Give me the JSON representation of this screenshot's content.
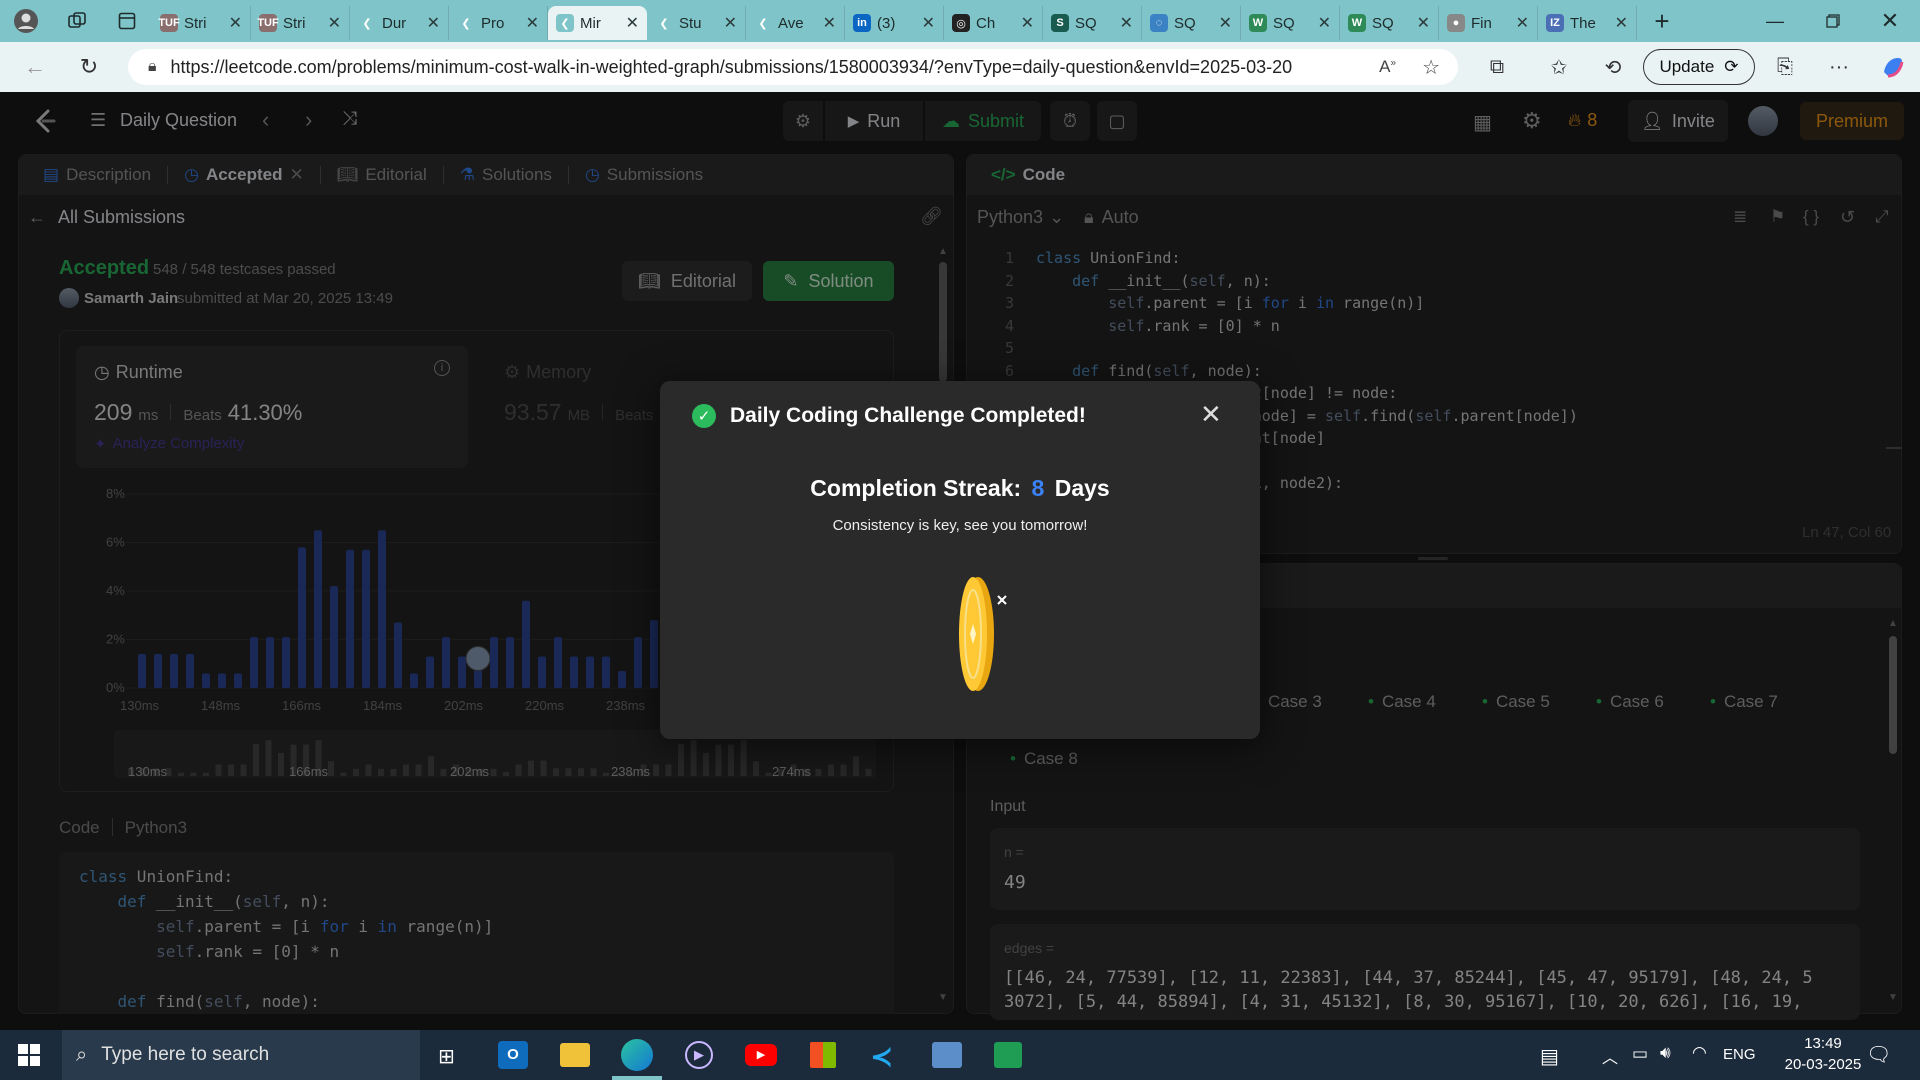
{
  "browser": {
    "tabs": [
      {
        "title": "Stri",
        "fav_color": "#8a6d6d",
        "fav": "TUF"
      },
      {
        "title": "Stri",
        "fav_color": "#8a6d6d",
        "fav": "TUF"
      },
      {
        "title": "Dur",
        "fav_color": "#7fc4c8",
        "fav": "❮"
      },
      {
        "title": "Pro",
        "fav_color": "#7fc4c8",
        "fav": "❮"
      },
      {
        "title": "Mir",
        "fav_color": "#7fc4c8",
        "fav": "❮"
      },
      {
        "title": "Stu",
        "fav_color": "#7fc4c8",
        "fav": "❮"
      },
      {
        "title": "Ave",
        "fav_color": "#7fc4c8",
        "fav": "❮"
      },
      {
        "title": "(3)",
        "fav_color": "#0a66c2",
        "fav": "in"
      },
      {
        "title": "Ch",
        "fav_color": "#222222",
        "fav": "◎"
      },
      {
        "title": "SQ",
        "fav_color": "#1a5b50",
        "fav": "S"
      },
      {
        "title": "SQ",
        "fav_color": "#3b82c4",
        "fav": "◌"
      },
      {
        "title": "SQ",
        "fav_color": "#2e8b57",
        "fav": "W"
      },
      {
        "title": "SQ",
        "fav_color": "#2e8b57",
        "fav": "W"
      },
      {
        "title": "Fin",
        "fav_color": "#888888",
        "fav": "●"
      },
      {
        "title": "The",
        "fav_color": "#4a6fb5",
        "fav": "IZ"
      }
    ],
    "url": "https://leetcode.com/problems/minimum-cost-walk-in-weighted-graph/submissions/1580003934/?envType=daily-question&envId=2025-03-20",
    "update_label": "Update"
  },
  "header": {
    "daily_label": "Daily Question",
    "run_label": "Run",
    "submit_label": "Submit",
    "streak_count": "8",
    "invite_label": "Invite",
    "premium_label": "Premium"
  },
  "left_panel": {
    "tabs": [
      "Description",
      "Accepted",
      "Editorial",
      "Solutions",
      "Submissions"
    ],
    "all_submissions": "All Submissions",
    "status": "Accepted",
    "testcases": "548 / 548 testcases passed",
    "user": "Samarth Jain",
    "submitted_at": "submitted at Mar 20, 2025 13:49",
    "editorial_btn": "Editorial",
    "solution_btn": "Solution",
    "runtime_label": "Runtime",
    "runtime_value": "209",
    "runtime_unit": "ms",
    "beats_label": "Beats",
    "runtime_beats": "41.30%",
    "analyze_label": "Analyze Complexity",
    "memory_label": "Memory",
    "memory_value": "93.57",
    "memory_unit": "MB",
    "memory_beats_label": "Beats",
    "code_label": "Code",
    "code_lang": "Python3",
    "code_lines": [
      "class UnionFind:",
      "    def __init__(self, n):",
      "        self.parent = [i for i in range(n)]",
      "        self.rank = [0] * n",
      "",
      "    def find(self, node):"
    ]
  },
  "chart_data": {
    "type": "bar",
    "y_ticks": [
      "8%",
      "6%",
      "4%",
      "2%",
      "0%"
    ],
    "ylim": [
      0,
      8
    ],
    "x_tick_labels": [
      "130ms",
      "148ms",
      "166ms",
      "184ms",
      "202ms",
      "220ms",
      "238ms"
    ],
    "values": [
      1.4,
      1.4,
      1.4,
      1.4,
      0.6,
      0.6,
      0.6,
      2.1,
      2.1,
      2.1,
      5.8,
      6.5,
      4.2,
      5.7,
      5.7,
      6.5,
      2.7,
      0.6,
      1.3,
      2.1,
      1.3,
      1.3,
      2.1,
      2.1,
      3.6,
      1.3,
      2.1,
      1.3,
      1.3,
      1.3,
      0.7,
      2.1,
      2.8,
      2.8
    ],
    "highlight_index": 21,
    "overview_labels": [
      "130ms",
      "166ms",
      "202ms",
      "238ms",
      "274ms"
    ]
  },
  "right_panel": {
    "code_title": "Code",
    "lang": "Python3",
    "auto_label": "Auto",
    "lines": [
      "class UnionFind:",
      "    def __init__(self, n):",
      "        self.parent = [i for i in range(n)]",
      "        self.rank = [0] * n",
      "",
      "    def find(self, node):",
      "        while self.parent[node] != node:",
      "            self.parent[node] = self.find(self.parent[node])",
      "        return self.parent[node]",
      "",
      "    def union(self, node1, node2):"
    ],
    "cursor_pos": "Ln 47, Col 60",
    "cases": [
      "Case 3",
      "Case 4",
      "Case 5",
      "Case 6",
      "Case 7",
      "Case 8"
    ],
    "input_label": "Input",
    "n_label": "n =",
    "n_value": "49",
    "edges_label": "edges =",
    "edges_line1": "[[46, 24, 77539], [12, 11, 22383], [44, 37, 85244], [45, 47, 95179], [48, 24, 5",
    "edges_line2": "3072], [5, 44, 85894], [4, 31, 45132], [8, 30, 95167], [10, 20, 626], [16, 19,"
  },
  "modal": {
    "title": "Daily Coding Challenge Completed!",
    "streak_label": "Completion Streak:",
    "streak_value": "8",
    "streak_unit": "Days",
    "message": "Consistency is key, see you tomorrow!"
  },
  "taskbar": {
    "search_placeholder": "Type here to search",
    "lang": "ENG",
    "time": "13:49",
    "date": "20-03-2025"
  },
  "colors": {
    "accent_green": "#2cbb5d",
    "accent_blue": "#3b82f6",
    "bar_blue": "#2e4a9e",
    "orange": "#ffa116"
  }
}
